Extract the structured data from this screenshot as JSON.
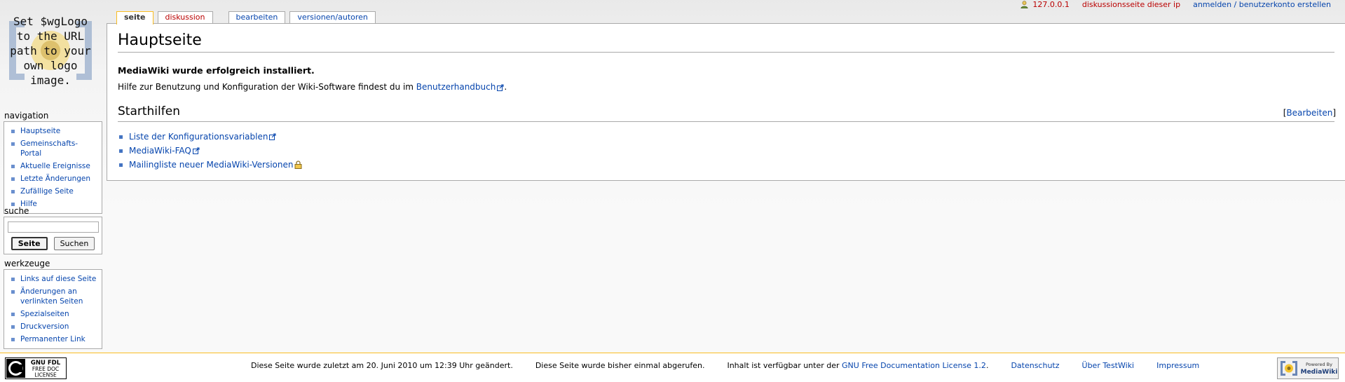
{
  "personal": {
    "ip": "127.0.0.1",
    "talk": "diskussionsseite dieser ip",
    "login": "anmelden / benutzerkonto erstellen"
  },
  "logo": {
    "text": "Set $wgLogo to the URL path to your own logo image."
  },
  "tabs": [
    {
      "label": "seite"
    },
    {
      "label": "diskussion"
    },
    {
      "label": "bearbeiten"
    },
    {
      "label": "versionen/autoren"
    }
  ],
  "content": {
    "title": "Hauptseite",
    "lead": "MediaWiki wurde erfolgreich installiert.",
    "help_prefix": "Hilfe zur Benutzung und Konfiguration der Wiki-Software findest du im ",
    "help_link": "Benutzerhandbuch",
    "help_suffix": ".",
    "section": {
      "title": "Starthilfen",
      "edit_open": "[",
      "edit_label": "Bearbeiten",
      "edit_close": "]",
      "links": [
        {
          "label": "Liste der Konfigurationsvariablen",
          "icon": "external-link-icon"
        },
        {
          "label": "MediaWiki-FAQ",
          "icon": "external-link-icon"
        },
        {
          "label": "Mailingliste neuer MediaWiki-Versionen",
          "icon": "lock-icon"
        }
      ]
    }
  },
  "navigation": {
    "title": "navigation",
    "items": [
      "Hauptseite",
      "Gemeinschafts-Portal",
      "Aktuelle Ereignisse",
      "Letzte Änderungen",
      "Zufällige Seite",
      "Hilfe"
    ]
  },
  "search": {
    "title": "suche",
    "value": "",
    "go_label": "Seite",
    "search_label": "Suchen"
  },
  "toolbox": {
    "title": "werkzeuge",
    "items": [
      "Links auf diese Seite",
      "Änderungen an verlinkten Seiten",
      "Spezialseiten",
      "Druckversion",
      "Permanenter Link"
    ]
  },
  "footer": {
    "copyright_badge": [
      "GNU FDL",
      "FREE DOC",
      "LICENSE"
    ],
    "powered_badge": [
      "Powered By",
      "MediaWiki"
    ],
    "lastmod": "Diese Seite wurde zuletzt am 20. Juni 2010 um 12:39 Uhr geändert.",
    "viewcount": "Diese Seite wurde bisher einmal abgerufen.",
    "copyright_prefix": "Inhalt ist verfügbar unter der ",
    "copyright_link": "GNU Free Documentation License 1.2",
    "copyright_suffix": ".",
    "privacy": "Datenschutz",
    "about": "Über TestWiki",
    "disclaimer": "Impressum"
  },
  "colors": {
    "link": "#0645ad",
    "new_link": "#ba0000",
    "accent": "#fabd23"
  }
}
